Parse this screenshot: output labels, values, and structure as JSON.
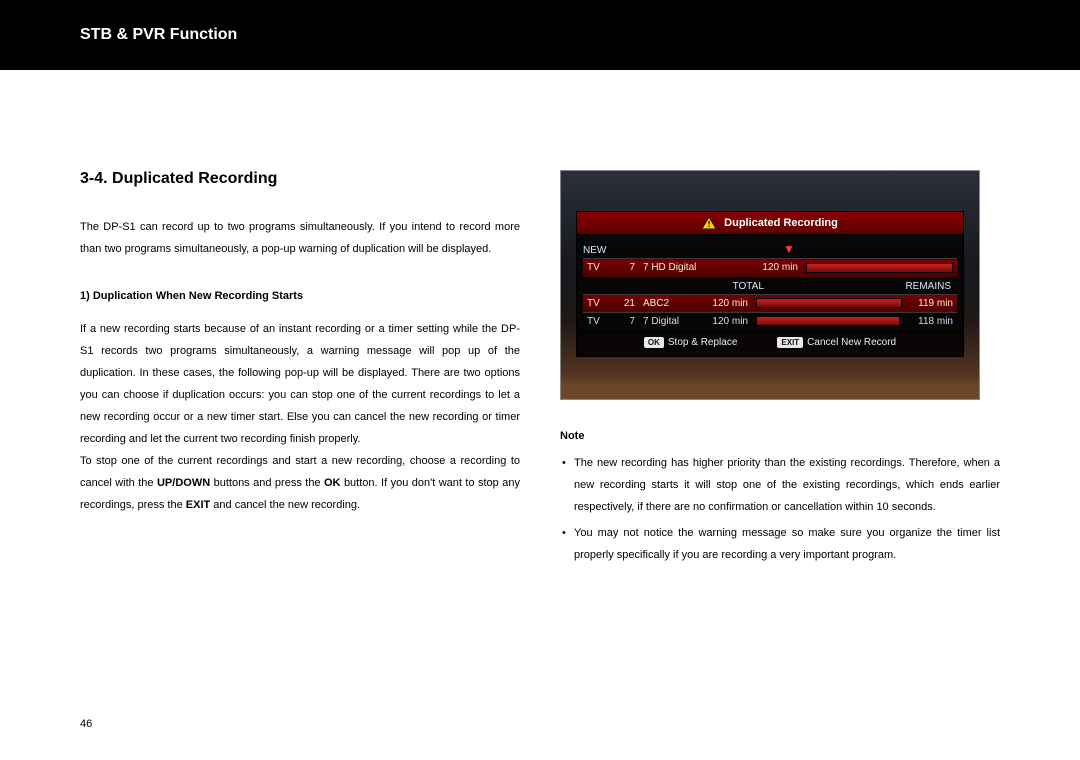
{
  "header": {
    "title": "STB & PVR Function"
  },
  "section": {
    "heading": "3-4. Duplicated Recording",
    "intro": "The DP-S1 can record up to two programs simultaneously. If you intend to record more than two programs simultaneously, a pop-up warning of duplication will be displayed.",
    "sub1_heading": "1) Duplication When New Recording Starts",
    "sub1_para1_a": "If a new recording starts because of an instant recording or a timer setting while the DP-S1 records two programs simultaneously, a warning message will pop up of the duplication. In these cases, the following pop-up will be displayed. There are two options you can choose if duplication occurs: you can stop one of the current recordings to let a new recording occur or a new timer start. Else you can cancel the new recording or timer recording and let the current two recording finish properly.",
    "sub1_para2_a": "To stop one of the current recordings and start a new recording, choose a recording to cancel with the ",
    "sub1_para2_b": "UP/DOWN",
    "sub1_para2_c": " buttons and press the ",
    "sub1_para2_d": "OK",
    "sub1_para2_e": " button. If you don't want to stop any recordings, press the ",
    "sub1_para2_f": "EXIT",
    "sub1_para2_g": " and cancel the new recording."
  },
  "screenshot": {
    "title": "Duplicated Recording",
    "new_label": "NEW",
    "total_label": "TOTAL",
    "remains_label": "REMAINS",
    "rows": {
      "new": {
        "type": "TV",
        "ch": "7",
        "name": "7 HD Digital",
        "total": "120 min",
        "remains": "",
        "fill": 100
      },
      "r1": {
        "type": "TV",
        "ch": "21",
        "name": "ABC2",
        "total": "120 min",
        "remains": "119 min",
        "fill": 99
      },
      "r2": {
        "type": "TV",
        "ch": "7",
        "name": "7 Digital",
        "total": "120 min",
        "remains": "118 min",
        "fill": 98
      }
    },
    "ok_key": "OK",
    "ok_label": "Stop & Replace",
    "exit_key": "EXIT",
    "exit_label": "Cancel New Record"
  },
  "note": {
    "heading": "Note",
    "items": [
      "The new recording has higher priority than the existing recordings. Therefore, when a new recording starts it will stop one of the existing recordings, which ends earlier respectively, if there are no confirmation or cancellation within 10 seconds.",
      "You may not notice the warning message so make sure you organize the timer list properly specifically if you are recording a very important program."
    ]
  },
  "page_number": "46"
}
